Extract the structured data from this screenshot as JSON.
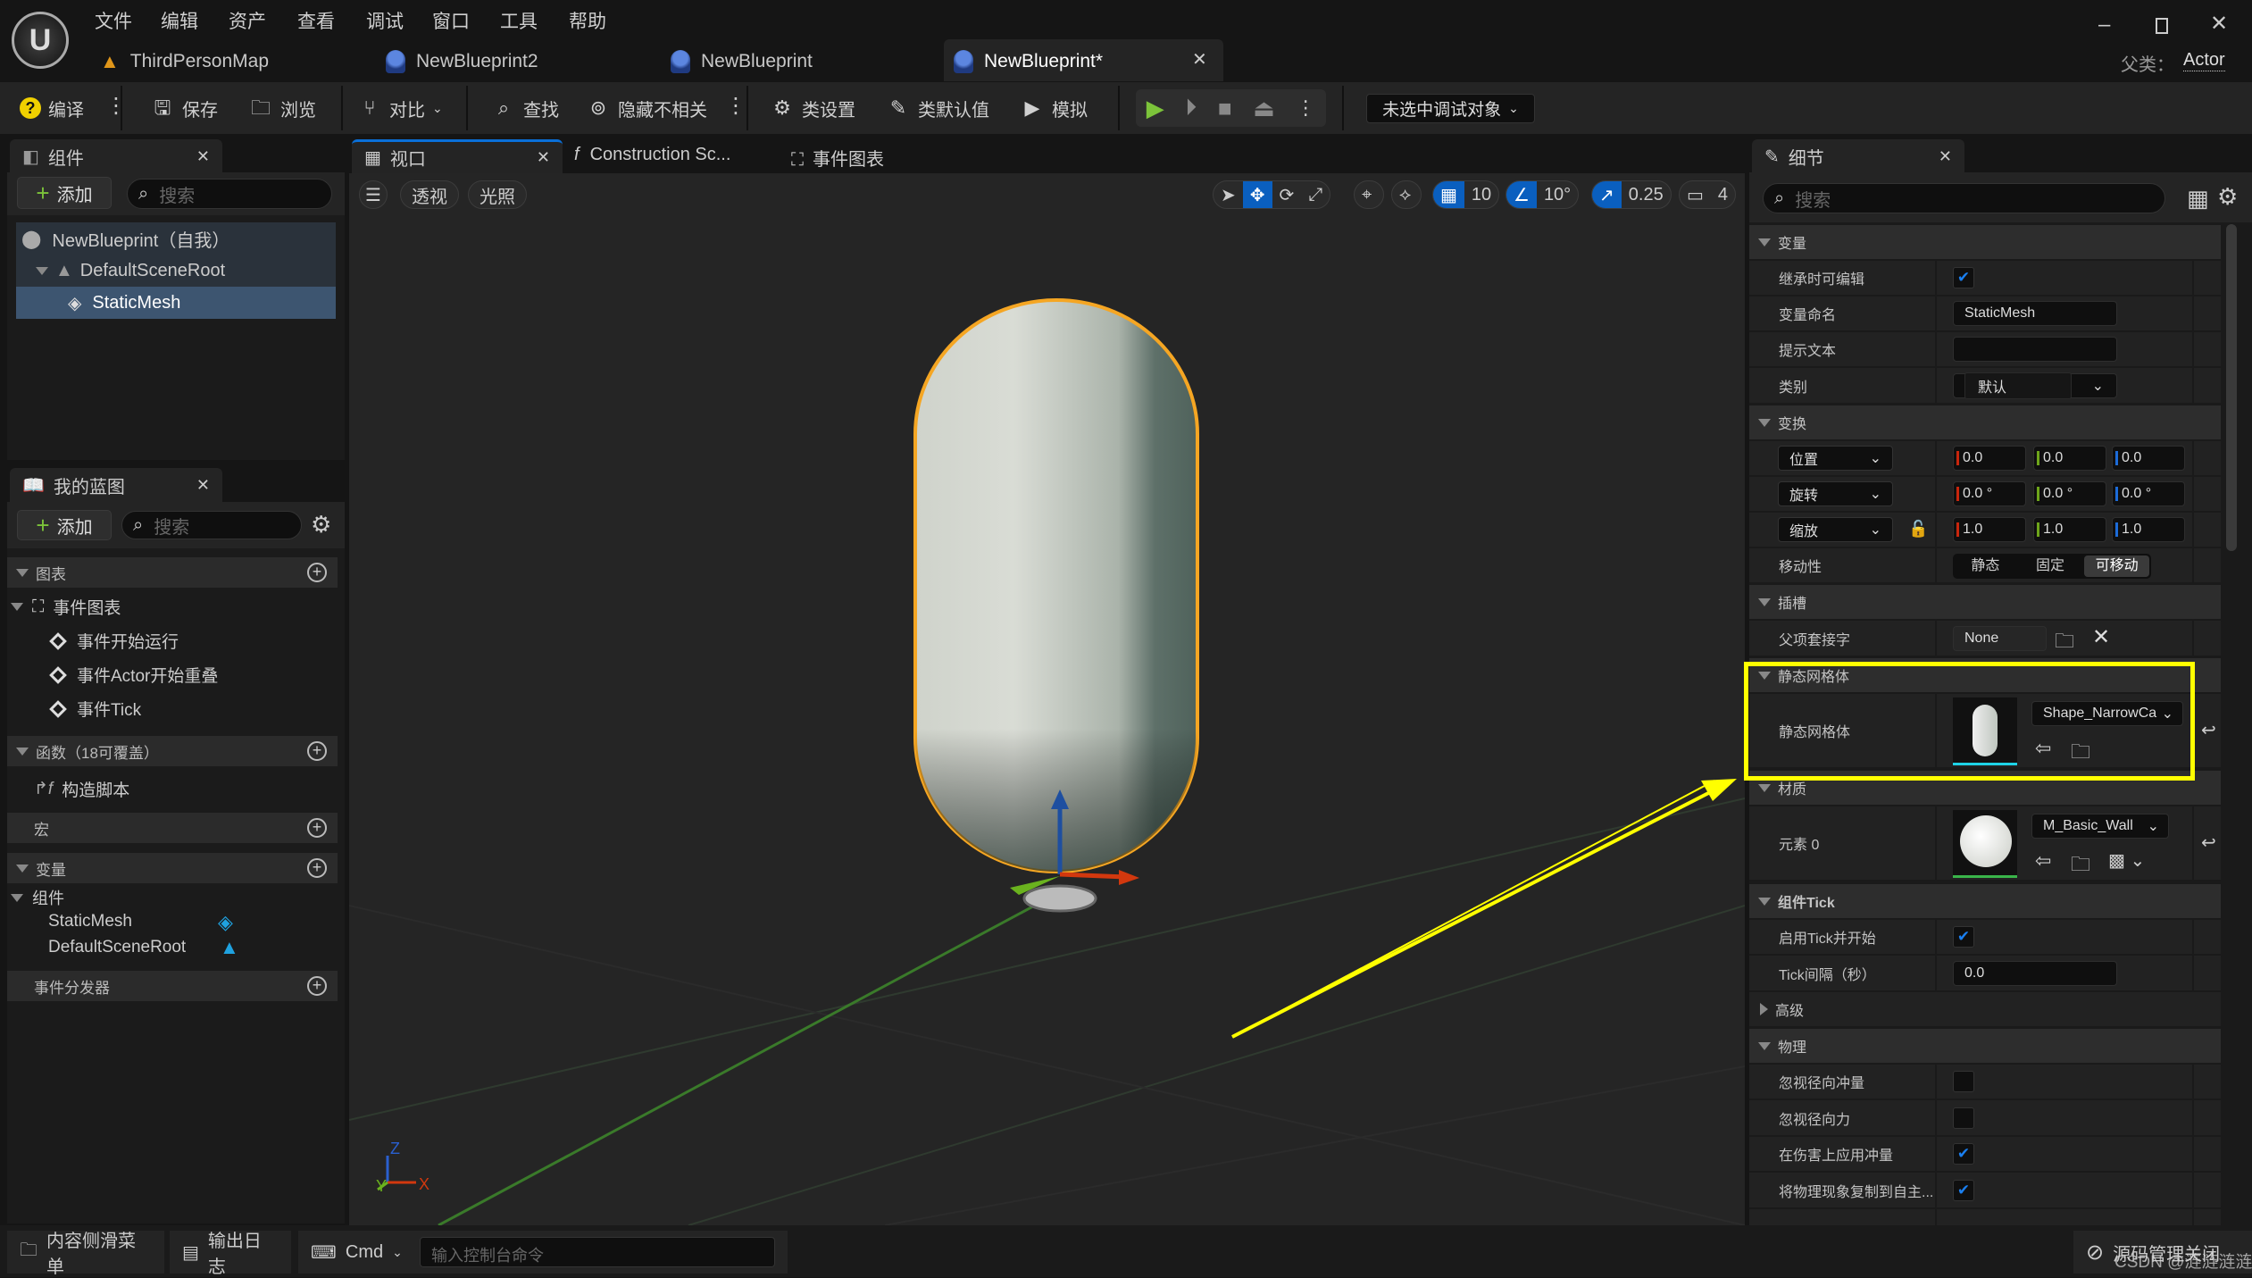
{
  "menu": [
    "文件",
    "编辑",
    "资产",
    "查看",
    "调试",
    "窗口",
    "工具",
    "帮助"
  ],
  "tabs": [
    {
      "label": "ThirdPersonMap",
      "icon": "level-icon"
    },
    {
      "label": "NewBlueprint2",
      "icon": "blueprint-icon"
    },
    {
      "label": "NewBlueprint",
      "icon": "blueprint-icon"
    },
    {
      "label": "NewBlueprint*",
      "icon": "blueprint-icon",
      "active": true
    }
  ],
  "parent_class": {
    "label": "父类：",
    "value": "Actor"
  },
  "toolbar": {
    "compile": "编译",
    "save": "保存",
    "browse": "浏览",
    "diff": "对比",
    "find": "查找",
    "hide_unrelated": "隐藏不相关",
    "class_settings": "类设置",
    "class_defaults": "类默认值",
    "simulate": "模拟",
    "debug_target": "未选中调试对象"
  },
  "components_panel": {
    "title": "组件",
    "add": "添加",
    "search_placeholder": "搜索",
    "tree": [
      "NewBlueprint（自我）",
      "DefaultSceneRoot",
      "StaticMesh"
    ]
  },
  "my_blueprint": {
    "title": "我的蓝图",
    "add": "添加",
    "search_placeholder": "搜索",
    "graphs": "图表",
    "event_graph": "事件图表",
    "events": [
      "事件开始运行",
      "事件Actor开始重叠",
      "事件Tick"
    ],
    "functions": "函数（18可覆盖）",
    "construction_script": "构造脚本",
    "macros": "宏",
    "variables": "变量",
    "components_group": "组件",
    "component_vars": [
      "StaticMesh",
      "DefaultSceneRoot"
    ],
    "dispatchers": "事件分发器"
  },
  "editor_tabs": [
    "视口",
    "Construction Sc...",
    "事件图表"
  ],
  "viewport": {
    "perspective": "透视",
    "lighting": "光照",
    "grid_snap": "10",
    "rotation_snap": "10°",
    "scale_snap": "0.25",
    "camera_speed": "4",
    "axis": {
      "z": "Z",
      "x": "X",
      "y": "Y"
    }
  },
  "details": {
    "title": "细节",
    "search_placeholder": "搜索",
    "variable_section": "变量",
    "editable_when_inherited": {
      "label": "继承时可编辑",
      "checked": true
    },
    "variable_name": {
      "label": "变量命名",
      "value": "StaticMesh"
    },
    "tooltip": {
      "label": "提示文本",
      "value": ""
    },
    "category": {
      "label": "类别",
      "value": "默认"
    },
    "transform_section": "变换",
    "location": {
      "label": "位置",
      "x": "0.0",
      "y": "0.0",
      "z": "0.0"
    },
    "rotation": {
      "label": "旋转",
      "x": "0.0 °",
      "y": "0.0 °",
      "z": "0.0 °"
    },
    "scale": {
      "label": "缩放",
      "x": "1.0",
      "y": "1.0",
      "z": "1.0"
    },
    "mobility": {
      "label": "移动性",
      "options": [
        "静态",
        "固定",
        "可移动"
      ],
      "selected": "可移动"
    },
    "sockets_section": "插槽",
    "parent_socket": {
      "label": "父项套接字",
      "value": "None"
    },
    "static_mesh_section": "静态网格体",
    "static_mesh": {
      "label": "静态网格体",
      "value": "Shape_NarrowCa"
    },
    "materials_section": "材质",
    "element0": {
      "label": "元素 0",
      "value": "M_Basic_Wall"
    },
    "tick_section": "组件Tick",
    "start_with_tick": {
      "label": "启用Tick并开始",
      "checked": true
    },
    "tick_interval": {
      "label": "Tick间隔（秒）",
      "value": "0.0"
    },
    "advanced_section": "高级",
    "physics_section": "物理",
    "physics_rows": [
      {
        "label": "忽视径向冲量",
        "checked": false
      },
      {
        "label": "忽视径向力",
        "checked": false
      },
      {
        "label": "在伤害上应用冲量",
        "checked": true
      },
      {
        "label": "将物理现象复制到自主...",
        "checked": true
      }
    ]
  },
  "bottom_bar": {
    "content_drawer": "内容侧滑菜单",
    "output_log": "输出日志",
    "cmd": "Cmd",
    "console_placeholder": "输入控制台命令",
    "source_control": "源码管理关闭"
  },
  "watermark": "CSDN @涟涟涟涟",
  "colors": {
    "accent": "#0a5fbf",
    "highlight": "#ffff00",
    "selection": "#f5a623",
    "play": "#7cc33a"
  }
}
